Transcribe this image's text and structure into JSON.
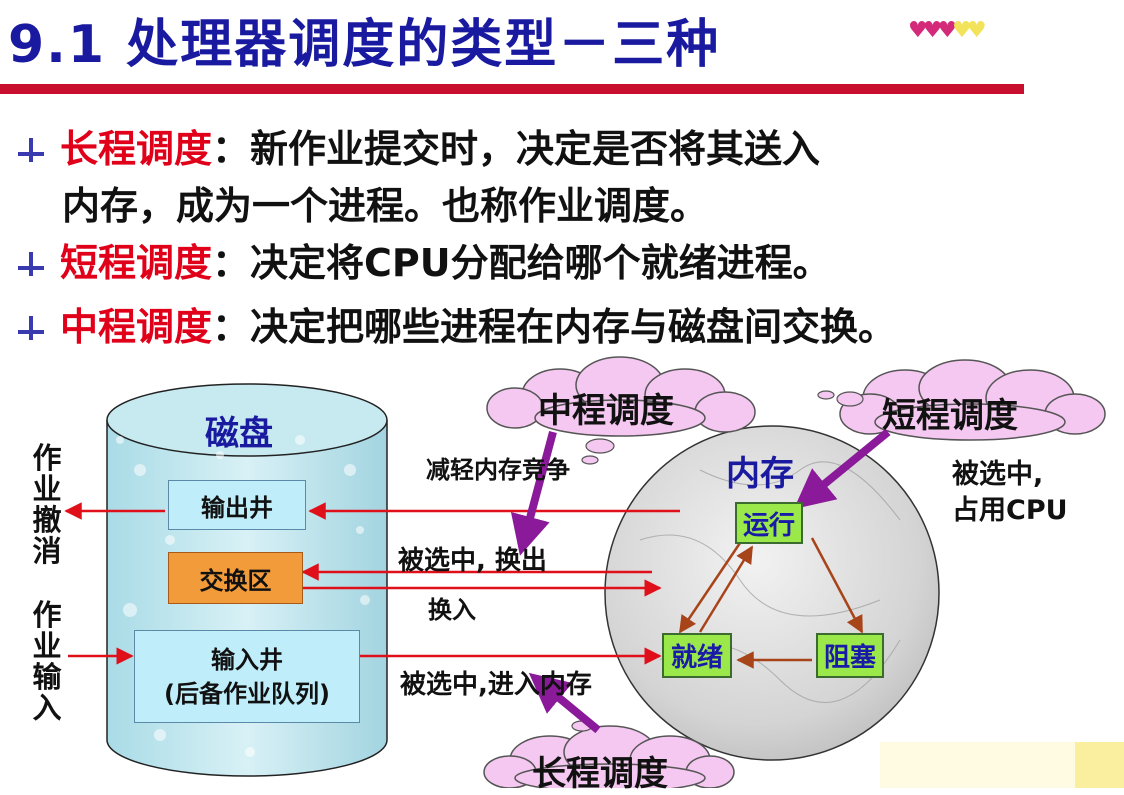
{
  "title": "9.1 处理器调度的类型－三种",
  "bullets": [
    {
      "term": "长程调度",
      "text": "：新作业提交时，决定是否将其送入",
      "cont": "内存，成为一个进程。也称作业调度。"
    },
    {
      "term": "短程调度",
      "text": "：决定将CPU分配给哪个就绪进程。"
    },
    {
      "term": "中程调度",
      "text": "：决定把哪些进程在内存与磁盘间交换。"
    }
  ],
  "diagram": {
    "disk_label": "磁盘",
    "output_well": "输出井",
    "swap_area": "交换区",
    "input_well_line1": "输入井",
    "input_well_line2": "(后备作业队列)",
    "memory_label": "内存",
    "state_running": "运行",
    "state_ready": "就绪",
    "state_blocked": "阻塞",
    "left_top_vertical": "作业撤消",
    "left_bottom_vertical": "作业输入",
    "cloud_mid": "中程调度",
    "cloud_short": "短程调度",
    "cloud_long": "长程调度",
    "reduce_contention": "减轻内存竞争",
    "selected_swapout": "被选中, 换出",
    "swapin": "换入",
    "selected_into_memory": "被选中,进入内存",
    "selected_cpu_line1": "被选中,",
    "selected_cpu_line2": "占用CPU"
  },
  "colors": {
    "title": "#1a1aa0",
    "term": "#e1001a",
    "rule": "#c8102e",
    "state_box": "#9ae84a",
    "cloud": "#f4c8f0",
    "purple_arrow": "#8a1a9a",
    "red_arrow": "#e0101a",
    "brown_arrow": "#a8441a"
  }
}
